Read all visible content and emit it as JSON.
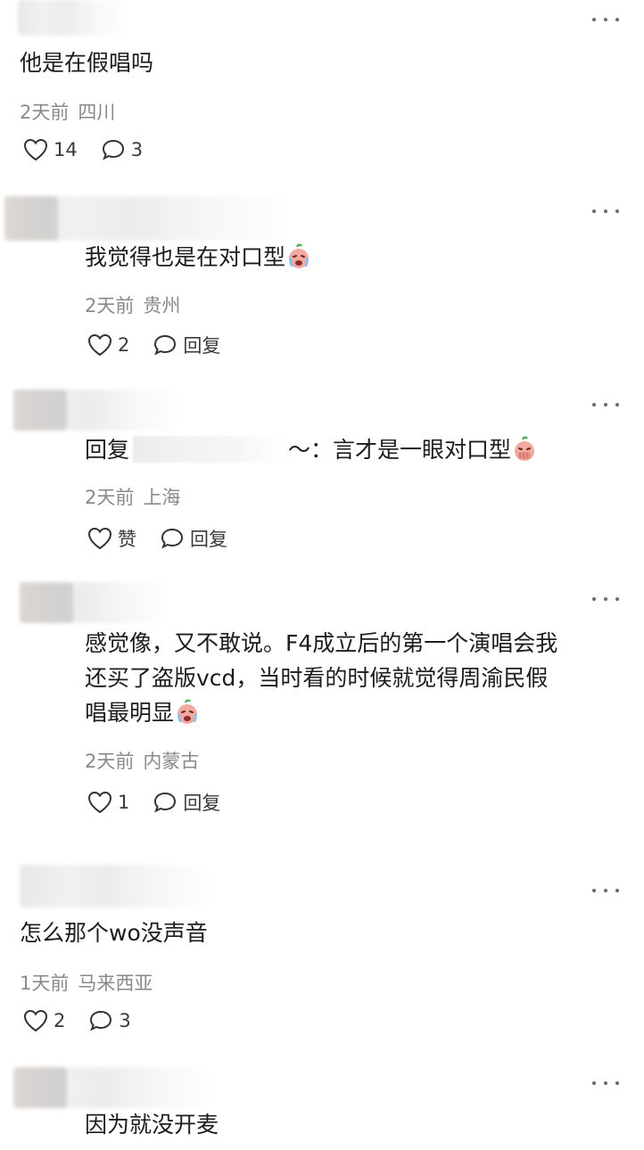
{
  "comments": [
    {
      "text": "他是在假唱吗",
      "time": "2天前",
      "location": "四川",
      "likes": "14",
      "replies": "3"
    },
    {
      "text": "我觉得也是在对口型",
      "time": "2天前",
      "location": "贵州",
      "likes": "2",
      "reply_label": "回复"
    },
    {
      "prefix": "回复",
      "text": "～：言才是一眼对口型",
      "time": "2天前",
      "location": "上海",
      "likes": "赞",
      "reply_label": "回复"
    },
    {
      "lines": [
        "感觉像，又不敢说。F4成立后的第一个演唱会我",
        "还买了盗版vcd，当时看的时候就觉得周渝民假",
        "唱最明显"
      ],
      "time": "2天前",
      "location": "内蒙古",
      "likes": "1",
      "reply_label": "回复"
    },
    {
      "text": "怎么那个wo没声音",
      "time": "1天前",
      "location": "马来西亚",
      "likes": "2",
      "replies": "3"
    },
    {
      "text": "因为就没开麦"
    }
  ],
  "icons": [
    "heart-icon",
    "comment-bubble-icon",
    "more-dots-icon",
    "crying-emoji-icon",
    "facepalm-emoji-icon"
  ]
}
